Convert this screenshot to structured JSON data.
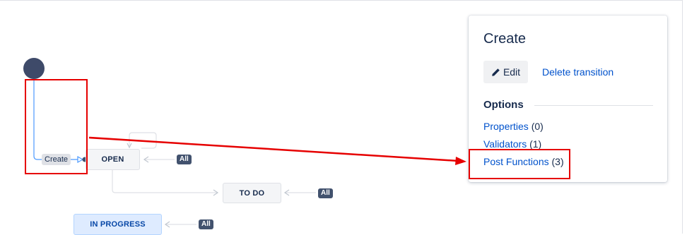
{
  "diagram": {
    "statuses": {
      "open": "OPEN",
      "todo": "TO DO",
      "inprogress": "IN PROGRESS"
    },
    "all_badge": "All",
    "create_transition_label": "Create"
  },
  "panel": {
    "title": "Create",
    "edit_label": "Edit",
    "delete_label": "Delete transition",
    "options_heading": "Options",
    "options": [
      {
        "label": "Properties",
        "count": "(0)"
      },
      {
        "label": "Validators",
        "count": "(1)"
      },
      {
        "label": "Post Functions",
        "count": "(3)"
      }
    ]
  },
  "colors": {
    "link": "#0052cc",
    "annotation_red": "#e60000",
    "start_node": "#3e4a69"
  }
}
